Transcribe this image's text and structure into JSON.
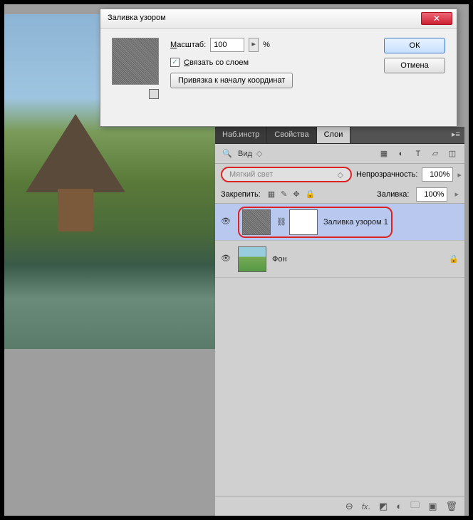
{
  "dialog": {
    "title": "Заливка узором",
    "scale_label": "Масштаб:",
    "scale_value": "100",
    "scale_suffix": "%",
    "link_layer": "Связать со слоем",
    "snap_origin": "Привязка к началу координат",
    "ok": "ОК",
    "cancel": "Отмена"
  },
  "panels": {
    "tabs": {
      "tools": "Наб.инстр",
      "props": "Свойства",
      "layers": "Слои"
    },
    "filter_label": "Вид",
    "blend_mode": "Мягкий свет",
    "opacity_label": "Непрозрачность:",
    "opacity_value": "100%",
    "lock_label": "Закрепить:",
    "fill_label": "Заливка:",
    "fill_value": "100%",
    "layer1_name": "Заливка узором 1",
    "layer2_name": "Фон"
  }
}
